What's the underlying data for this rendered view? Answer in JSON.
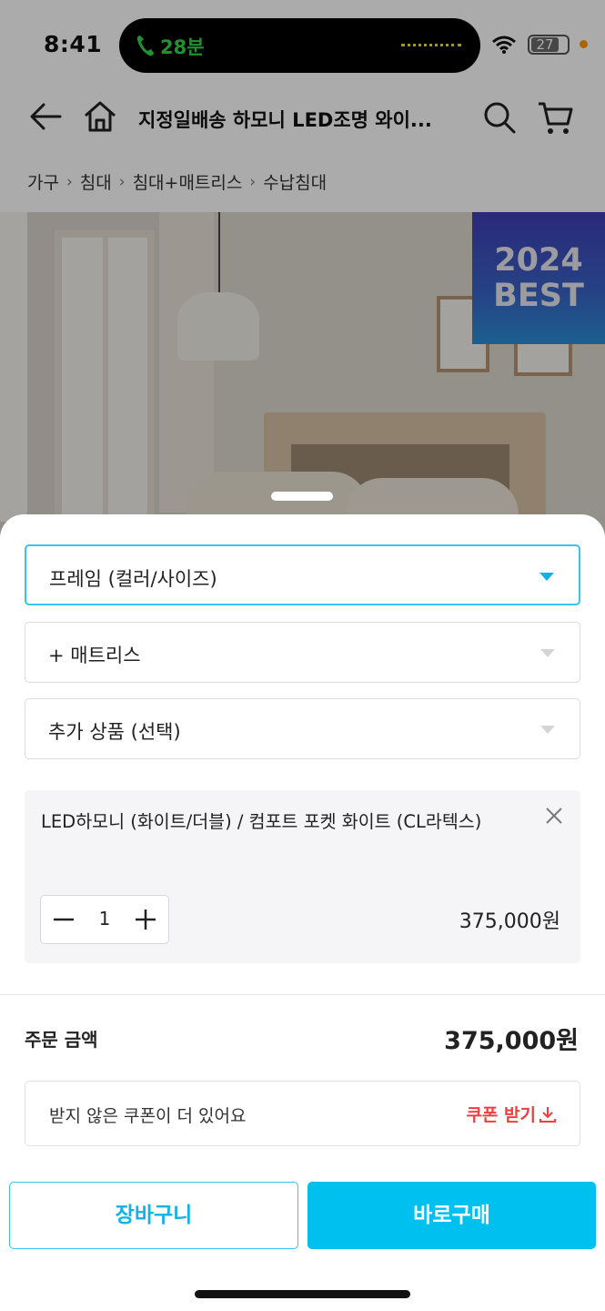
{
  "status_bar": {
    "time": "8:41",
    "call_duration": "28분",
    "battery": "27"
  },
  "header": {
    "title": "지정일배송 하모니 LED조명 와이..."
  },
  "breadcrumb": [
    "가구",
    "침대",
    "침대+매트리스",
    "수납침대"
  ],
  "hero": {
    "badge_year": "2024",
    "badge_text": "BEST",
    "badge_color": "#3a4fbf"
  },
  "sheet": {
    "selects": [
      {
        "label": "프레임 (컬러/사이즈)",
        "active": true
      },
      {
        "label": "+ 매트리스",
        "active": false
      },
      {
        "label": "추가 상품 (선택)",
        "active": false
      }
    ],
    "selected_option": {
      "name": "LED하모니 (화이트/더블) / 컴포트 포켓 화이트 (CL라텍스)",
      "quantity": "1",
      "price": "375,000원"
    },
    "total": {
      "label": "주문 금액",
      "price": "375,000원"
    },
    "coupon": {
      "text": "받지 않은 쿠폰이 더 있어요",
      "button": "쿠폰 받기"
    },
    "buttons": {
      "cart": "장바구니",
      "buy": "바로구매"
    }
  },
  "colors": {
    "accent": "#35c5f0",
    "buy_button": "#00c0f0",
    "coupon_red": "#f03e3e"
  }
}
